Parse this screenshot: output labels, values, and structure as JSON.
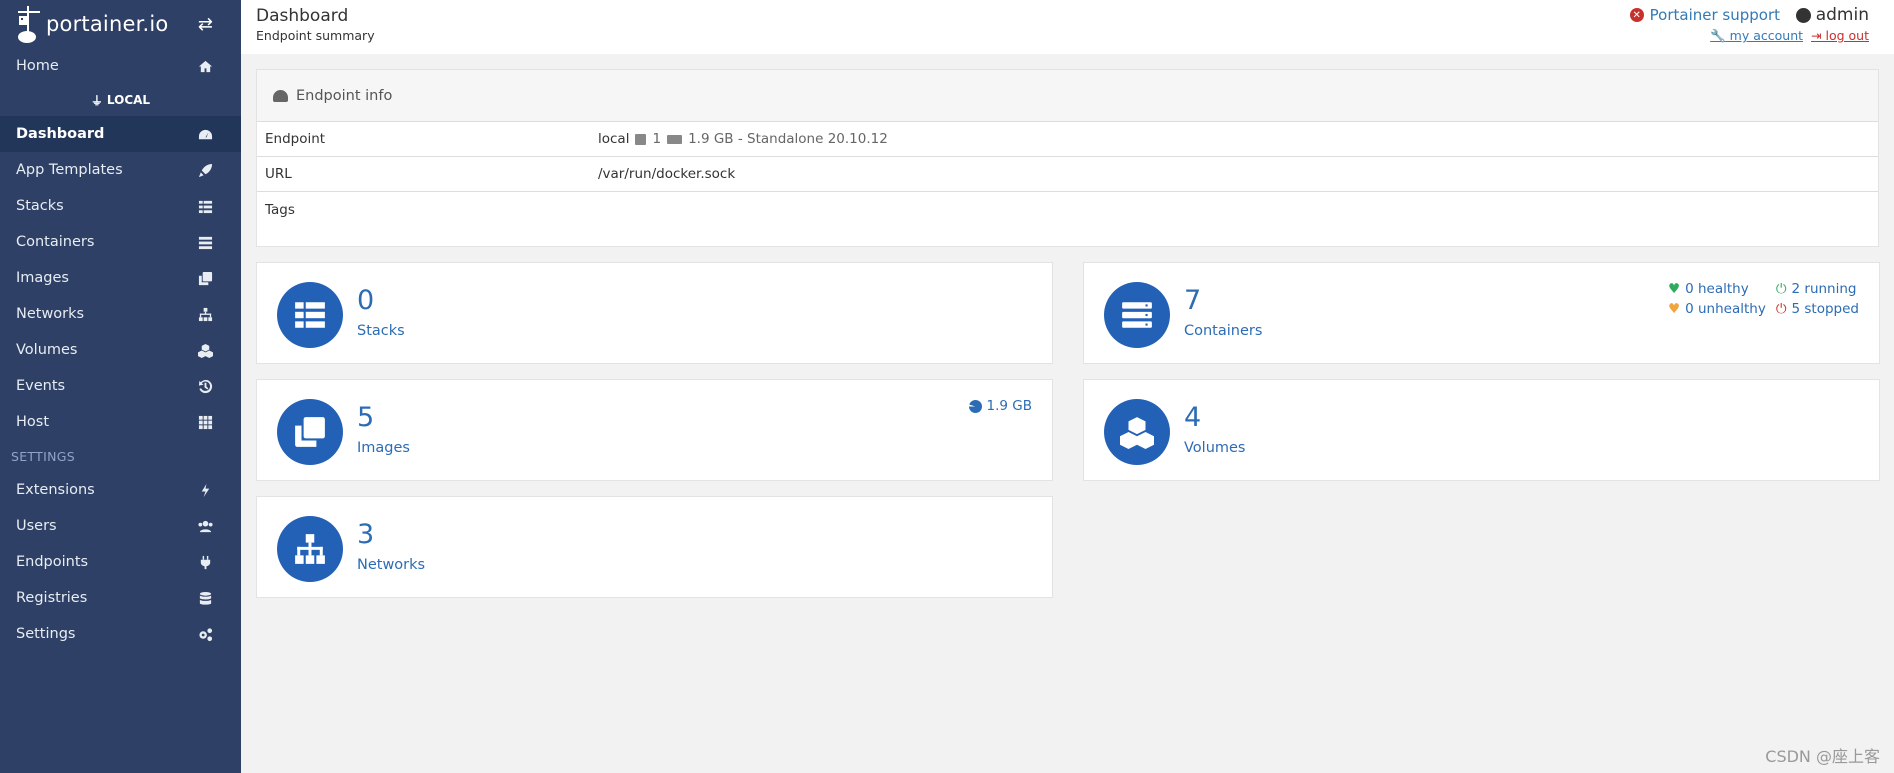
{
  "brand": {
    "name": "portainer.io"
  },
  "sidebar": {
    "home_label": "Home",
    "endpoint_label": "LOCAL",
    "endpoint_items": [
      {
        "label": "Dashboard",
        "icon": "tachometer-icon"
      },
      {
        "label": "App Templates",
        "icon": "rocket-icon"
      },
      {
        "label": "Stacks",
        "icon": "th-list-icon"
      },
      {
        "label": "Containers",
        "icon": "server-icon"
      },
      {
        "label": "Images",
        "icon": "clone-icon"
      },
      {
        "label": "Networks",
        "icon": "sitemap-icon"
      },
      {
        "label": "Volumes",
        "icon": "cubes-icon"
      },
      {
        "label": "Events",
        "icon": "history-icon"
      },
      {
        "label": "Host",
        "icon": "th-icon"
      }
    ],
    "settings_label": "SETTINGS",
    "settings_items": [
      {
        "label": "Extensions",
        "icon": "bolt-icon"
      },
      {
        "label": "Users",
        "icon": "users-icon"
      },
      {
        "label": "Endpoints",
        "icon": "plug-icon"
      },
      {
        "label": "Registries",
        "icon": "database-icon"
      },
      {
        "label": "Settings",
        "icon": "cogs-icon"
      }
    ]
  },
  "header": {
    "title": "Dashboard",
    "subtitle": "Endpoint summary",
    "support_label": "Portainer support",
    "username": "admin",
    "my_account_label": " my account ",
    "logout_label": " log out"
  },
  "endpoint_info": {
    "title": "Endpoint info",
    "rows": {
      "endpoint": {
        "key": "Endpoint",
        "name": "local",
        "cpus": "1",
        "memory": "1.9 GB - Standalone 20.10.12"
      },
      "url": {
        "key": "URL",
        "value": "/var/run/docker.sock"
      },
      "tags": {
        "key": "Tags",
        "value": ""
      }
    }
  },
  "widgets": {
    "stacks": {
      "count": "0",
      "label": "Stacks"
    },
    "containers": {
      "count": "7",
      "label": "Containers",
      "healthy": "0 healthy",
      "running": "2 running",
      "unhealthy": "0 unhealthy",
      "stopped": "5 stopped"
    },
    "images": {
      "count": "5",
      "label": "Images",
      "size": "1.9 GB"
    },
    "volumes": {
      "count": "4",
      "label": "Volumes"
    },
    "networks": {
      "count": "3",
      "label": "Networks"
    }
  },
  "colors": {
    "sidebar_bg": "#2e4065",
    "widget_icon_bg": "#2361b7",
    "accent_text": "#2c6cb4",
    "healthy": "#2dab5f",
    "warning": "#f0a53e",
    "danger": "#c9302c"
  },
  "watermark": "CSDN @座上客"
}
